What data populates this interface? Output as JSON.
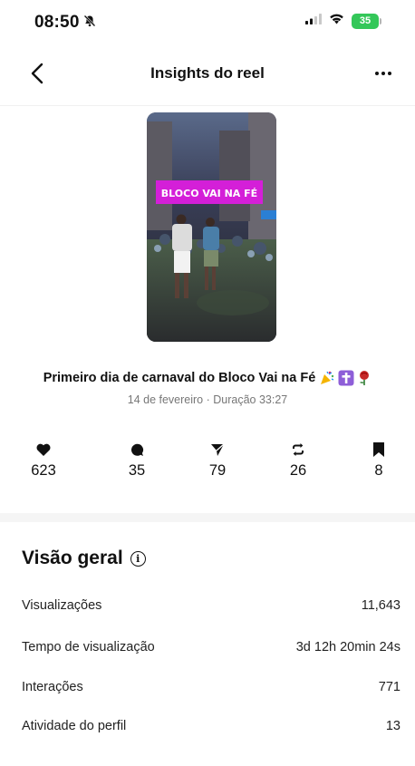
{
  "status": {
    "time": "08:50",
    "battery": "35"
  },
  "header": {
    "title": "Insights do reel"
  },
  "reel": {
    "thumbnail_sign": "BLOCO VAI NA FÉ",
    "caption": "Primeiro dia de carnaval do Bloco Vai na Fé",
    "caption_emojis": [
      "party-popper-icon",
      "latin-cross-icon",
      "rose-icon"
    ],
    "meta": "14 de fevereiro · Duração 33:27"
  },
  "stats": {
    "likes": "623",
    "comments": "35",
    "shares": "79",
    "reposts": "26",
    "saves": "8"
  },
  "overview": {
    "title": "Visão geral",
    "rows": [
      {
        "label": "Visualizações",
        "value": "11,643"
      },
      {
        "label": "Tempo de visualização",
        "value": "3d 12h 20min 24s"
      },
      {
        "label": "Interações",
        "value": "771"
      },
      {
        "label": "Atividade do perfil",
        "value": "13"
      }
    ]
  }
}
